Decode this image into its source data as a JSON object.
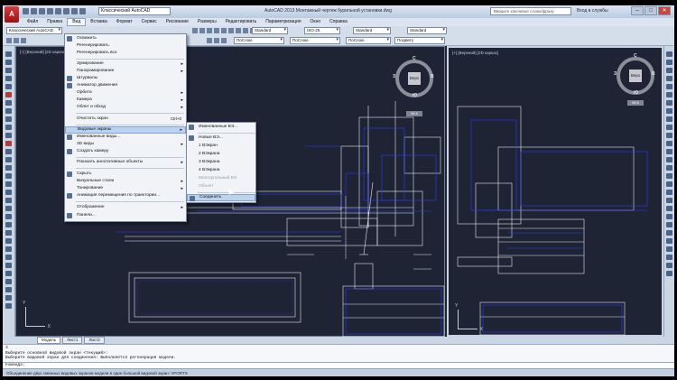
{
  "window": {
    "workspace": "Классический AutoCAD",
    "title": "AutoCAD 2013  Монтажный чертеж бурильной установки.dwg",
    "search_placeholder": "Введите ключевое слово/фразу",
    "signin": "Вход в службы",
    "minimize": "–",
    "maximize": "□",
    "close": "✕"
  },
  "menubar": [
    "Файл",
    "Правка",
    "Вид",
    "Вставка",
    "Формат",
    "Сервис",
    "Рисование",
    "Размеры",
    "Редактировать",
    "Параметризация",
    "Окно",
    "Справка"
  ],
  "toolbar": {
    "workspace_combo": "Классический AutoCAD",
    "text_style": "Standard",
    "dim_style": "ISO-25",
    "table_style": "Standard",
    "mleader_style": "Standard",
    "color": "ПоСлою",
    "linetype": "ПоСлою",
    "lineweight": "ПоСлою",
    "plotstyle": "ПоЦвету"
  },
  "viewports": {
    "left_label": "[+] [Верхний] [2D каркас]",
    "right_label": "[+] [Верхний] [2D каркас]",
    "viewcube_face": "Верх",
    "dir_n": "С",
    "dir_s": "Ю",
    "dir_w": "З",
    "dir_e": "В",
    "msk": "МСК",
    "ucs_y": "Y",
    "ucs_x": "X"
  },
  "view_menu": {
    "items": [
      {
        "label": "Освежить",
        "icon": "redraw-icon"
      },
      {
        "label": "Регенерировать"
      },
      {
        "label": "Регенерировать все"
      },
      {
        "label": "Зумирование",
        "submenu": true
      },
      {
        "label": "Панорамирование",
        "submenu": true
      },
      {
        "label": "Штурвалы",
        "icon": "steering-wheel-icon"
      },
      {
        "label": "Аниматор движения",
        "icon": "motion-icon"
      },
      {
        "label": "Орбита",
        "submenu": true
      },
      {
        "label": "Камера",
        "submenu": true
      },
      {
        "label": "Облет и обход",
        "submenu": true
      },
      {
        "label": "Очистить экран",
        "shortcut": "Ctrl+0"
      },
      {
        "label": "Видовые экраны",
        "submenu": true,
        "highlighted": true
      },
      {
        "label": "Именованные виды...",
        "icon": "named-views-icon"
      },
      {
        "label": "3D виды",
        "submenu": true
      },
      {
        "label": "Создать камеру",
        "icon": "camera-icon"
      },
      {
        "label": "Показать аннотативные объекты",
        "submenu": true
      },
      {
        "label": "Скрыть",
        "icon": "hide-icon"
      },
      {
        "label": "Визуальные стили",
        "submenu": true
      },
      {
        "label": "Тонирование",
        "submenu": true
      },
      {
        "label": "Анимация перемещения по траектории...",
        "icon": "path-animation-icon"
      },
      {
        "label": "Отображение",
        "submenu": true
      },
      {
        "label": "Панели...",
        "icon": "toolbars-icon"
      }
    ]
  },
  "viewports_submenu": {
    "items": [
      {
        "label": "Именованные ВЭ...",
        "icon": "named-viewports-icon"
      },
      {
        "label": "Новые ВЭ...",
        "icon": "new-viewports-icon"
      },
      {
        "label": "1 ВЭкран"
      },
      {
        "label": "2 ВЭкрана"
      },
      {
        "label": "3 ВЭкрана"
      },
      {
        "label": "4 ВЭкрана"
      },
      {
        "label": "Многоугольный ВЭ",
        "disabled": true
      },
      {
        "label": "Объект",
        "disabled": true
      },
      {
        "label": "Соединить",
        "highlighted": true
      }
    ]
  },
  "layout_tabs": [
    "Модель",
    "Лист1",
    "Лист2"
  ],
  "command": {
    "line1": "3",
    "line2": "Выберите основной видовой экран <текущий>:",
    "line3": "Выберите видовой экран для соединения: Выполняется регенерация модели.",
    "prompt": "Команда:"
  },
  "status_text": "Объединение двух смежных видовых экранов модели в один большой видовой экран: VPORTS"
}
